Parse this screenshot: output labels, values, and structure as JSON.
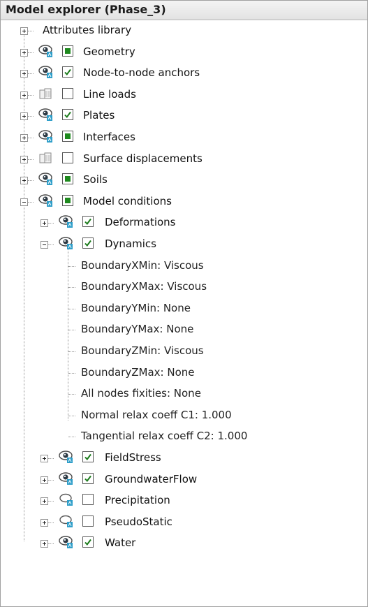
{
  "panel": {
    "title": "Model explorer (Phase_3)"
  },
  "tree": [
    {
      "key": "attributes_library",
      "label": "Attributes library",
      "level": 0,
      "expander": "plus",
      "icon": "none",
      "check": "none"
    },
    {
      "key": "geometry",
      "label": "Geometry",
      "level": 0,
      "expander": "plus",
      "icon": "eye-icon",
      "check": "filled"
    },
    {
      "key": "node_to_node_anchors",
      "label": "Node-to-node anchors",
      "level": 0,
      "expander": "plus",
      "icon": "eye-icon",
      "check": "checked"
    },
    {
      "key": "line_loads",
      "label": "Line loads",
      "level": 0,
      "expander": "plus",
      "icon": "inactive-object-icon",
      "check": "unchecked"
    },
    {
      "key": "plates",
      "label": "Plates",
      "level": 0,
      "expander": "plus",
      "icon": "eye-icon",
      "check": "checked"
    },
    {
      "key": "interfaces",
      "label": "Interfaces",
      "level": 0,
      "expander": "plus",
      "icon": "eye-icon",
      "check": "filled"
    },
    {
      "key": "surface_displacements",
      "label": "Surface displacements",
      "level": 0,
      "expander": "plus",
      "icon": "inactive-object-icon",
      "check": "unchecked"
    },
    {
      "key": "soils",
      "label": "Soils",
      "level": 0,
      "expander": "plus",
      "icon": "eye-icon",
      "check": "filled"
    },
    {
      "key": "model_conditions",
      "label": "Model conditions",
      "level": 0,
      "expander": "minus",
      "icon": "eye-icon",
      "check": "filled"
    },
    {
      "key": "deformations",
      "label": "Deformations",
      "level": 1,
      "expander": "plus",
      "icon": "eye-icon",
      "check": "checked"
    },
    {
      "key": "dynamics",
      "label": "Dynamics",
      "level": 1,
      "expander": "minus",
      "icon": "eye-icon",
      "check": "checked"
    },
    {
      "key": "boundary_xmin",
      "label": "BoundaryXMin: Viscous",
      "level": 2,
      "expander": "none",
      "icon": "none",
      "check": "none"
    },
    {
      "key": "boundary_xmax",
      "label": "BoundaryXMax: Viscous",
      "level": 2,
      "expander": "none",
      "icon": "none",
      "check": "none"
    },
    {
      "key": "boundary_ymin",
      "label": "BoundaryYMin: None",
      "level": 2,
      "expander": "none",
      "icon": "none",
      "check": "none"
    },
    {
      "key": "boundary_ymax",
      "label": "BoundaryYMax: None",
      "level": 2,
      "expander": "none",
      "icon": "none",
      "check": "none"
    },
    {
      "key": "boundary_zmin",
      "label": "BoundaryZMin: Viscous",
      "level": 2,
      "expander": "none",
      "icon": "none",
      "check": "none"
    },
    {
      "key": "boundary_zmax",
      "label": "BoundaryZMax: None",
      "level": 2,
      "expander": "none",
      "icon": "none",
      "check": "none"
    },
    {
      "key": "all_nodes_fixities",
      "label": "All nodes fixities: None",
      "level": 2,
      "expander": "none",
      "icon": "none",
      "check": "none"
    },
    {
      "key": "normal_relax_coeff",
      "label": "Normal relax coeff C1: 1.000",
      "level": 2,
      "expander": "none",
      "icon": "none",
      "check": "none"
    },
    {
      "key": "tangential_relax_coeff",
      "label": "Tangential relax coeff C2: 1.000",
      "level": 2,
      "expander": "none",
      "icon": "none",
      "check": "none"
    },
    {
      "key": "field_stress",
      "label": "FieldStress",
      "level": 1,
      "expander": "plus",
      "icon": "eye-icon",
      "check": "checked"
    },
    {
      "key": "groundwater_flow",
      "label": "GroundwaterFlow",
      "level": 1,
      "expander": "plus",
      "icon": "eye-icon",
      "check": "checked"
    },
    {
      "key": "precipitation",
      "label": "Precipitation",
      "level": 1,
      "expander": "plus",
      "icon": "eye-closed-icon",
      "check": "unchecked"
    },
    {
      "key": "pseudo_static",
      "label": "PseudoStatic",
      "level": 1,
      "expander": "plus",
      "icon": "eye-closed-icon",
      "check": "unchecked"
    },
    {
      "key": "water",
      "label": "Water",
      "level": 1,
      "expander": "plus",
      "icon": "eye-icon",
      "check": "checked"
    }
  ],
  "colors": {
    "check_fill": "#1f8a1f",
    "check_mark": "#1a7a1a",
    "eye_badge": "#2e9ec9"
  }
}
